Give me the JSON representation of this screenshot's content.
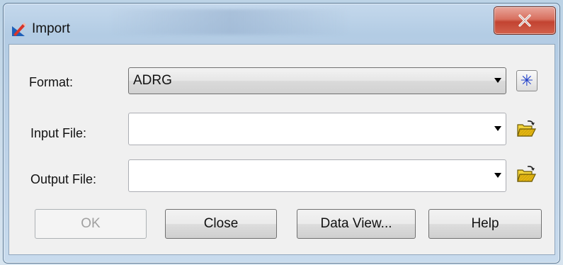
{
  "window": {
    "title": "Import",
    "close_icon": "close-x-icon",
    "app_icon": "import-pencil-icon"
  },
  "form": {
    "format_label": "Format:",
    "format_value": "ADRG",
    "input_label": "Input File:",
    "input_value": "",
    "output_label": "Output File:",
    "output_value": ""
  },
  "icons": {
    "format_extra": "asterisk-icon",
    "browse": "open-folder-icon"
  },
  "buttons": {
    "ok": "OK",
    "close": "Close",
    "data_view": "Data View...",
    "help": "Help"
  },
  "colors": {
    "close_button": "#c94a37",
    "asterisk": "#1f3fc9",
    "folder": "#e8c21c"
  }
}
